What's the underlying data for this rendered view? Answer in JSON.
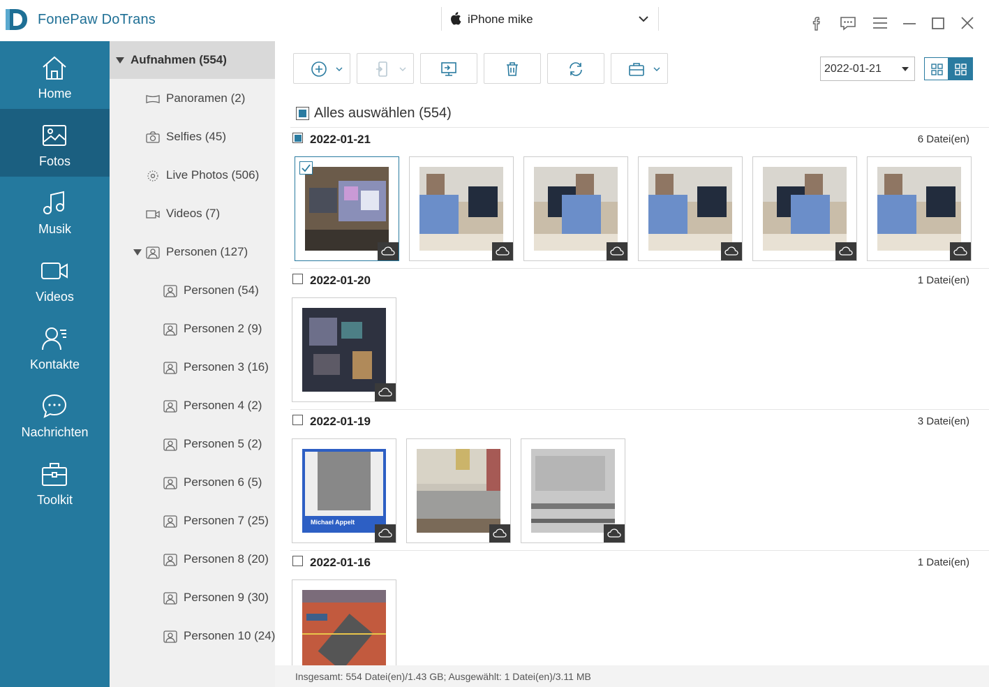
{
  "app": {
    "title": "FonePaw DoTrans"
  },
  "device": {
    "name": "iPhone mike"
  },
  "sidebar": {
    "items": [
      {
        "label": "Home"
      },
      {
        "label": "Fotos"
      },
      {
        "label": "Musik"
      },
      {
        "label": "Videos"
      },
      {
        "label": "Kontakte"
      },
      {
        "label": "Nachrichten"
      },
      {
        "label": "Toolkit"
      }
    ],
    "active": "Fotos"
  },
  "albums": {
    "root": "Aufnahmen (554)",
    "items": [
      {
        "label": "Panoramen (2)",
        "icon": "panorama-icon"
      },
      {
        "label": "Selfies (45)",
        "icon": "camera-icon"
      },
      {
        "label": "Live Photos (506)",
        "icon": "live-photo-icon"
      },
      {
        "label": "Videos (7)",
        "icon": "video-icon"
      },
      {
        "label": "Personen (127)",
        "icon": "person-album-icon"
      },
      {
        "label": "Personen (54)",
        "icon": "person-album-icon"
      },
      {
        "label": "Personen 2 (9)",
        "icon": "person-album-icon"
      },
      {
        "label": "Personen 3 (16)",
        "icon": "person-album-icon"
      },
      {
        "label": "Personen 4 (2)",
        "icon": "person-album-icon"
      },
      {
        "label": "Personen 5 (2)",
        "icon": "person-album-icon"
      },
      {
        "label": "Personen 6 (5)",
        "icon": "person-album-icon"
      },
      {
        "label": "Personen 7 (25)",
        "icon": "person-album-icon"
      },
      {
        "label": "Personen 8 (20)",
        "icon": "person-album-icon"
      },
      {
        "label": "Personen 9 (30)",
        "icon": "person-album-icon"
      },
      {
        "label": "Personen 10 (24)",
        "icon": "person-album-icon"
      }
    ]
  },
  "toolbar": {
    "date_filter": "2022-01-21",
    "buttons": [
      "add-icon",
      "export-to-device-icon",
      "export-to-pc-icon",
      "delete-icon",
      "convert-icon",
      "toolbox-icon"
    ]
  },
  "content": {
    "select_all": "Alles auswählen (554)",
    "groups": [
      {
        "date": "2022-01-21",
        "count": "6 Datei(en)",
        "photos": 6,
        "selected_index": 0
      },
      {
        "date": "2022-01-20",
        "count": "1 Datei(en)",
        "photos": 1
      },
      {
        "date": "2022-01-19",
        "count": "3 Datei(en)",
        "photos": 3,
        "caption": "Michael Appelt"
      },
      {
        "date": "2022-01-16",
        "count": "1 Datei(en)",
        "photos": 1
      }
    ]
  },
  "status": {
    "text": "Insgesamt: 554 Datei(en)/1.43 GB; Ausgewählt: 1 Datei(en)/3.11 MB"
  },
  "colors": {
    "sidebar": "#24799e",
    "sidebar_active": "#1b5f80",
    "accent": "#2a7ba0"
  }
}
